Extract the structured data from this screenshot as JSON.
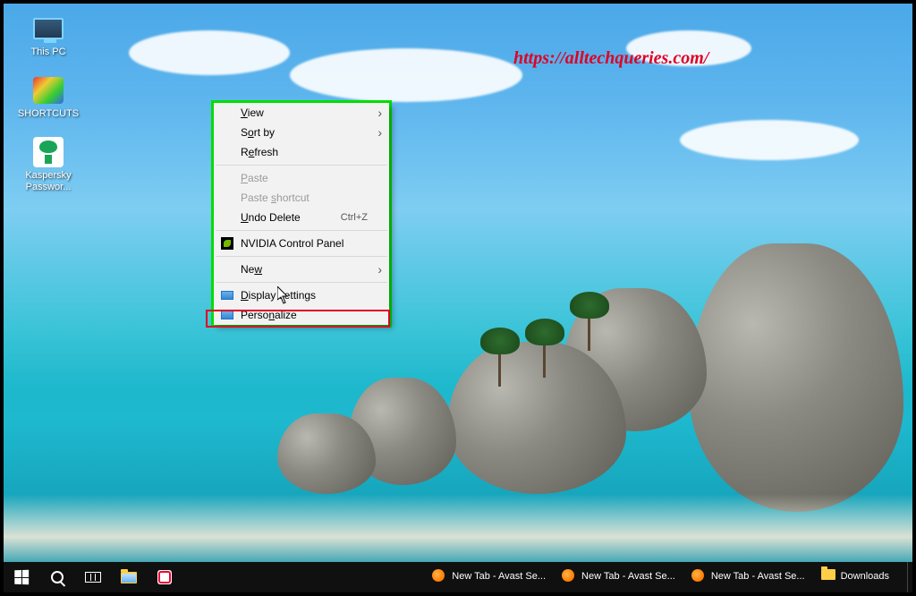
{
  "watermark": "https://alltechqueries.com/",
  "desktop_icons": [
    {
      "name": "this-pc",
      "label": "This PC"
    },
    {
      "name": "shortcuts",
      "label": "SHORTCUTS"
    },
    {
      "name": "kaspersky",
      "label": "Kaspersky Passwor..."
    }
  ],
  "context_menu": {
    "items": [
      {
        "id": "view",
        "label": "View",
        "submenu": true,
        "accel_index": 0
      },
      {
        "id": "sort-by",
        "label": "Sort by",
        "submenu": true,
        "accel_index": 1
      },
      {
        "id": "refresh",
        "label": "Refresh",
        "accel_index": 1
      },
      {
        "sep": true
      },
      {
        "id": "paste",
        "label": "Paste",
        "disabled": true,
        "accel_index": 0
      },
      {
        "id": "paste-shortcut",
        "label": "Paste shortcut",
        "disabled": true,
        "accel_index": 6
      },
      {
        "id": "undo-delete",
        "label": "Undo Delete",
        "shortcut": "Ctrl+Z",
        "accel_index": 0
      },
      {
        "sep": true
      },
      {
        "id": "nvidia",
        "label": "NVIDIA Control Panel",
        "icon": "nvidia"
      },
      {
        "sep": true
      },
      {
        "id": "new",
        "label": "New",
        "submenu": true,
        "accel_index": 2
      },
      {
        "sep": true
      },
      {
        "id": "display-settings",
        "label": "Display settings",
        "icon": "settings",
        "accel_index": 0
      },
      {
        "id": "personalize",
        "label": "Personalize",
        "icon": "settings",
        "accel_index": 5,
        "highlight": "red"
      }
    ]
  },
  "taskbar": {
    "system": [
      {
        "id": "start",
        "name": "start-button"
      },
      {
        "id": "search",
        "name": "search-button"
      },
      {
        "id": "taskview",
        "name": "task-view-button"
      },
      {
        "id": "explorer",
        "name": "file-explorer-button"
      },
      {
        "id": "redapp",
        "name": "pinned-app-button"
      }
    ],
    "tasks": [
      {
        "id": "avast1",
        "label": "New Tab - Avast Se...",
        "icon": "avast"
      },
      {
        "id": "avast2",
        "label": "New Tab - Avast Se...",
        "icon": "avast"
      },
      {
        "id": "avast3",
        "label": "New Tab - Avast Se...",
        "icon": "avast"
      },
      {
        "id": "downloads",
        "label": "Downloads",
        "icon": "folder"
      }
    ]
  }
}
